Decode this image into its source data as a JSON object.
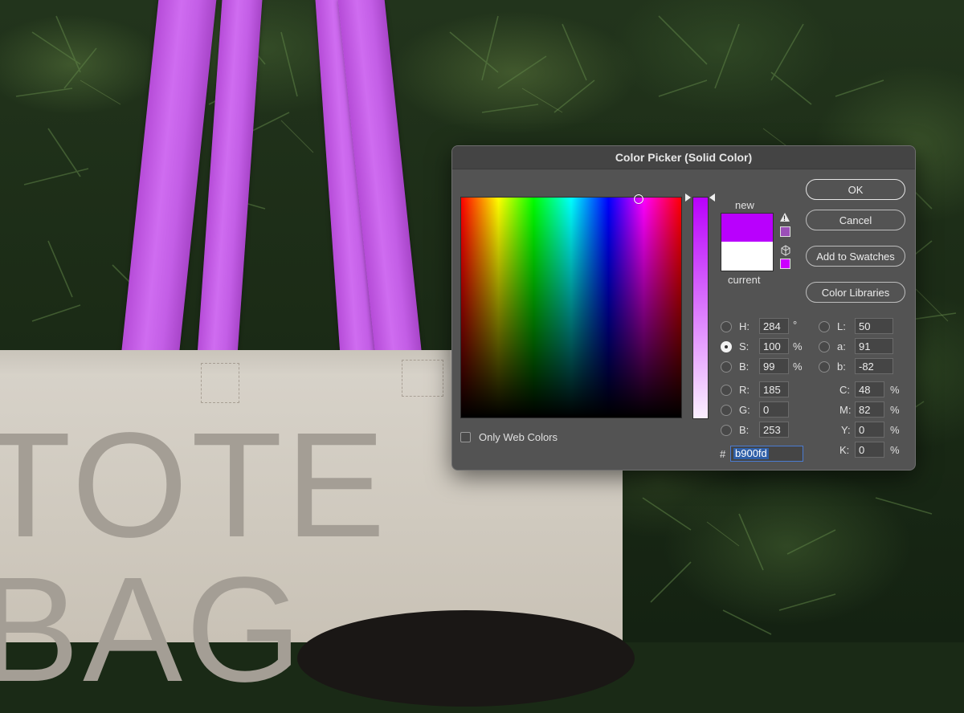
{
  "dialog": {
    "title": "Color Picker (Solid Color)",
    "new_label": "new",
    "current_label": "current",
    "new_color": "#b900fd",
    "current_color": "#ffffff",
    "buttons": {
      "ok": "OK",
      "cancel": "Cancel",
      "add_to_swatches": "Add to Swatches",
      "color_libraries": "Color Libraries"
    },
    "only_web_colors_label": "Only Web Colors",
    "only_web_colors_checked": false,
    "hsb": {
      "h": {
        "label": "H:",
        "value": "284",
        "unit": "°"
      },
      "s": {
        "label": "S:",
        "value": "100",
        "unit": "%"
      },
      "b": {
        "label": "B:",
        "value": "99",
        "unit": "%"
      }
    },
    "rgb": {
      "r": {
        "label": "R:",
        "value": "185"
      },
      "g": {
        "label": "G:",
        "value": "0"
      },
      "b": {
        "label": "B:",
        "value": "253"
      }
    },
    "lab": {
      "l": {
        "label": "L:",
        "value": "50"
      },
      "a": {
        "label": "a:",
        "value": "91"
      },
      "b": {
        "label": "b:",
        "value": "-82"
      }
    },
    "cmyk": {
      "c": {
        "label": "C:",
        "value": "48",
        "unit": "%"
      },
      "m": {
        "label": "M:",
        "value": "82",
        "unit": "%"
      },
      "y": {
        "label": "Y:",
        "value": "0",
        "unit": "%"
      },
      "k": {
        "label": "K:",
        "value": "0",
        "unit": "%"
      }
    },
    "selected_channel": "S",
    "hex_label": "#",
    "hex_value": "b900fd",
    "gamut_warning_color": "#9b4fb8",
    "websafe_color": "#cc00ff"
  },
  "background": {
    "bag_text_line1": "TOTE",
    "bag_text_line2": "BAG",
    "strap_color": "#c35ee6"
  }
}
